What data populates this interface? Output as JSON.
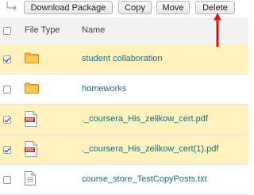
{
  "toolbar": {
    "download_label": "Download Package",
    "copy_label": "Copy",
    "move_label": "Move",
    "delete_label": "Delete"
  },
  "header": {
    "file_type": "File Type",
    "name": "Name"
  },
  "rows": [
    {
      "name": "student collaboration",
      "type": "folder",
      "checked": true
    },
    {
      "name": "homeworks",
      "type": "folder",
      "checked": false
    },
    {
      "name": "._coursera_His_zelikow_cert.pdf",
      "type": "pdf",
      "checked": true
    },
    {
      "name": "._coursera_His_zelikow_cert(1).pdf",
      "type": "pdf",
      "checked": true
    },
    {
      "name": "course_store_TestCopyPosts.txt",
      "type": "txt",
      "checked": false
    }
  ],
  "colors": {
    "selected_row": "#fdf2c0",
    "link": "#1b6d7a",
    "annotation_arrow": "#e01010"
  }
}
